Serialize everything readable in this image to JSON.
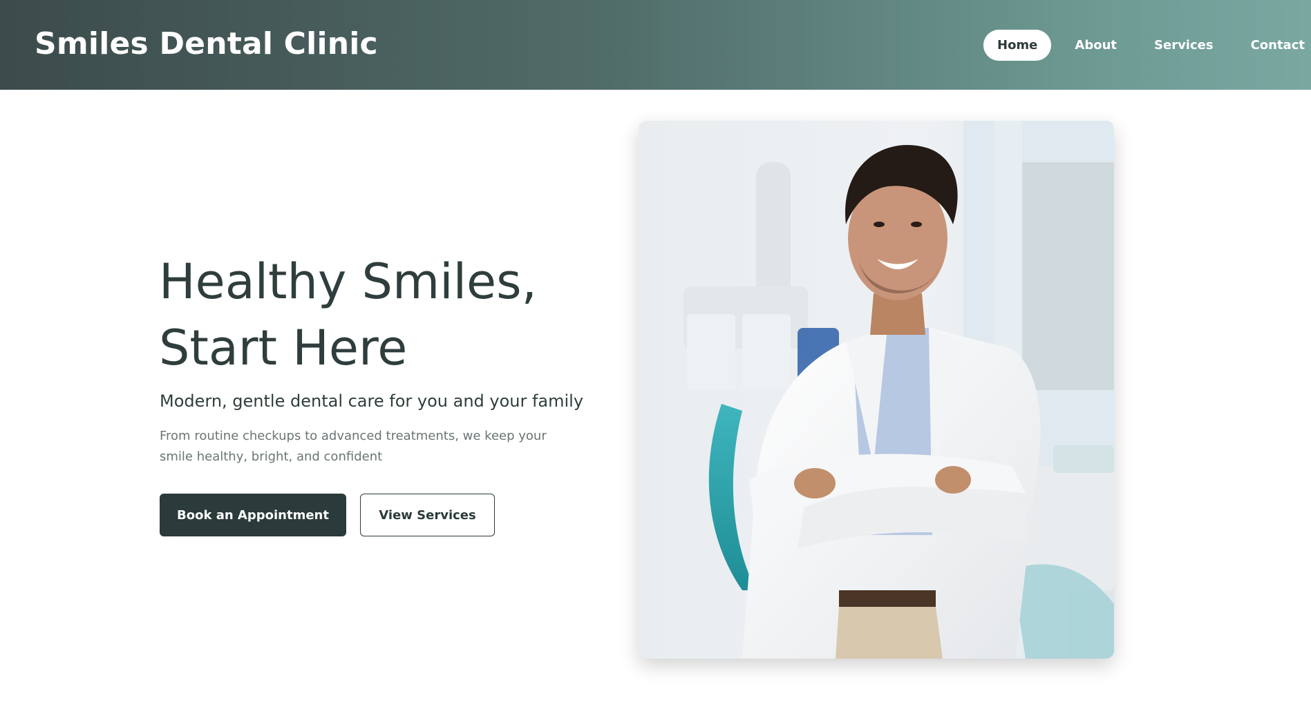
{
  "header": {
    "brand": "Smiles Dental Clinic",
    "nav": [
      {
        "label": "Home",
        "active": true
      },
      {
        "label": "About",
        "active": false
      },
      {
        "label": "Services",
        "active": false
      },
      {
        "label": "Contact",
        "active": false
      }
    ]
  },
  "hero": {
    "title_line1": "Healthy Smiles,",
    "title_line2": "Start Here",
    "subtitle": "Modern, gentle dental care for you and your family",
    "description": "From routine checkups to advanced treatments, we keep your smile healthy, bright, and confident",
    "primary_button": "Book an Appointment",
    "secondary_button": "View Services"
  },
  "image": {
    "subject": "smiling dentist in white coat with arms crossed in dental clinic"
  },
  "colors": {
    "header_gradient_start": "#3c4b4b",
    "header_gradient_end": "#7aa8a1",
    "primary_dark": "#2b3a3a",
    "text_muted": "#6a7474"
  }
}
